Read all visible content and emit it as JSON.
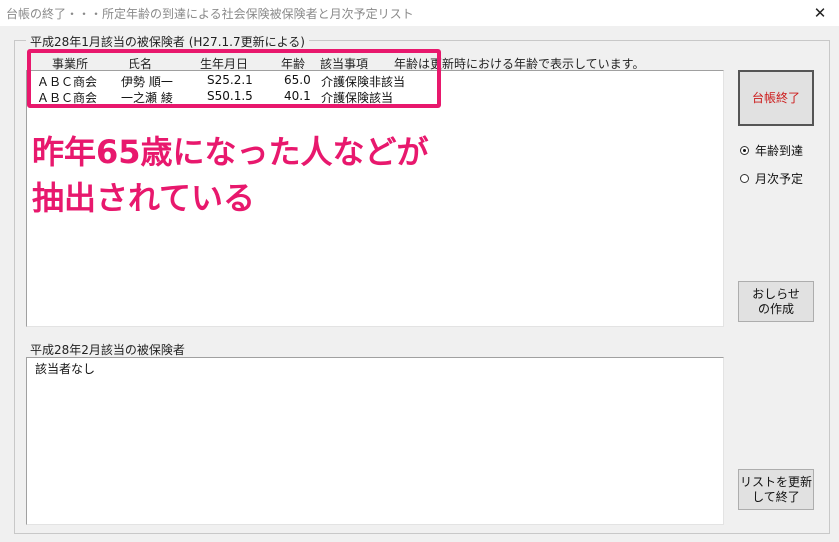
{
  "window": {
    "title": "台帳の終了・・・所定年齢の到達による社会保険被保険者と月次予定リスト",
    "close_glyph": "✕"
  },
  "group": {
    "legend": "平成28年1月該当の被保険者 (H27.1.7更新による)"
  },
  "list1": {
    "columns": [
      "事業所",
      "氏名",
      "生年月日",
      "年齢",
      "該当事項",
      "年齢は更新時における年齢で表示しています。"
    ],
    "rows": [
      {
        "office": "ＡＢＣ商会",
        "name": "伊勢 順一",
        "birth": "S25.2.1",
        "age": "65.0",
        "item": "介護保険非該当"
      },
      {
        "office": "ＡＢＣ商会",
        "name": "一之瀬 綾",
        "birth": "S50.1.5",
        "age": "40.1",
        "item": "介護保険該当"
      }
    ]
  },
  "annotation": {
    "line1": "昨年65歳になった人などが",
    "line2": "抽出されている",
    "color": "#e8186d"
  },
  "list2": {
    "label": "平成28年2月該当の被保険者",
    "rows": [
      "該当者なし"
    ]
  },
  "buttons": {
    "close_ledger": "台帳終了",
    "close_ledger_color": "#cc1a1a",
    "notice_line1": "おしらせ",
    "notice_line2": "の作成",
    "update_line1": "リストを更新",
    "update_line2": "して終了"
  },
  "options": [
    {
      "label": "年齢到達",
      "checked": true
    },
    {
      "label": "月次予定",
      "checked": false
    }
  ]
}
